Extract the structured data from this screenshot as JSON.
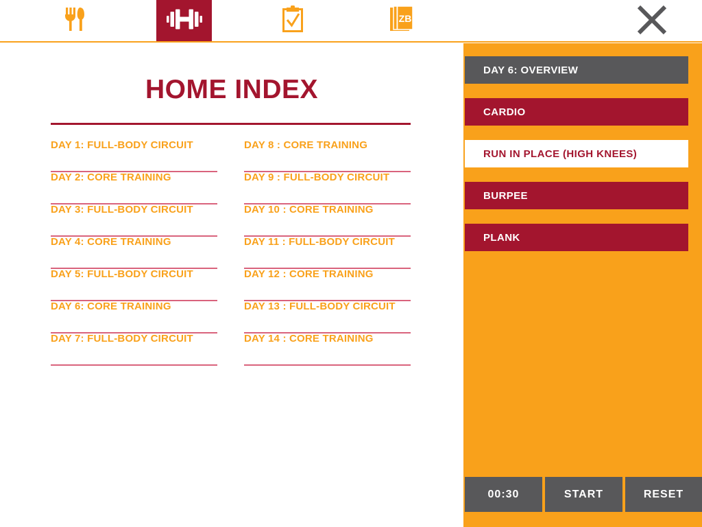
{
  "topbar": {
    "tabs": [
      {
        "id": "nutrition",
        "icon": "fork-knife-icon",
        "label": "Nutrition",
        "active": false
      },
      {
        "id": "workout",
        "icon": "dumbbell-icon",
        "label": "Workout",
        "active": true
      },
      {
        "id": "checklist",
        "icon": "clipboard-check-icon",
        "label": "Checklist",
        "active": false
      },
      {
        "id": "journal",
        "icon": "journal-zb-icon",
        "label": "ZB",
        "active": false
      }
    ],
    "journal_icon_text": "ZB",
    "close_label": "✕",
    "accent_orange": "#F9A11B",
    "accent_red": "#A3152E",
    "accent_gray": "#58585A"
  },
  "main": {
    "title": "HOME INDEX",
    "columns": [
      {
        "id": "left",
        "items": [
          "DAY 1: FULL-BODY CIRCUIT",
          "DAY 2: CORE TRAINING",
          "DAY 3: FULL-BODY CIRCUIT",
          "DAY 4: CORE TRAINING",
          "DAY 5: FULL-BODY CIRCUIT",
          "DAY 6: CORE TRAINING",
          "DAY 7: FULL-BODY CIRCUIT"
        ]
      },
      {
        "id": "right",
        "items": [
          "DAY 8 : CORE TRAINING",
          "DAY 9 : FULL-BODY CIRCUIT",
          "DAY 10 : CORE TRAINING",
          "DAY 11 : FULL-BODY CIRCUIT",
          "DAY 12 : CORE TRAINING",
          "DAY 13 : FULL-BODY CIRCUIT",
          "DAY 14 : CORE TRAINING"
        ]
      }
    ]
  },
  "panel": {
    "items": [
      {
        "label": "DAY 6: OVERVIEW",
        "style": "overview"
      },
      {
        "label": "CARDIO",
        "style": "section"
      },
      {
        "label": "RUN IN PLACE (HIGH KNEES)",
        "style": "active"
      },
      {
        "label": "BURPEE",
        "style": "section"
      },
      {
        "label": "PLANK",
        "style": "section"
      }
    ],
    "timer": {
      "time": "00:30",
      "start_label": "START",
      "reset_label": "RESET"
    }
  }
}
